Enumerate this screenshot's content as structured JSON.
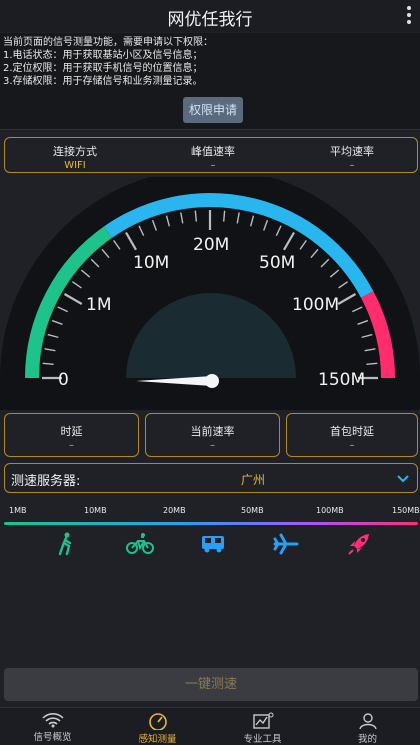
{
  "app": {
    "title": "网优任我行"
  },
  "permission": {
    "intro": "当前页面的信号测量功能，需要申请以下权限：",
    "items": [
      "1.电话状态：用于获取基站小区及信号信息；",
      "2.定位权限：用于获取手机信号的位置信息；",
      "3.存储权限：用于存储信号和业务测量记录。"
    ],
    "button": "权限申请"
  },
  "stats_top": {
    "connection_label": "连接方式",
    "connection_value": "WIFI",
    "peak_label": "峰值速率",
    "peak_value": "–",
    "avg_label": "平均速率",
    "avg_value": "–"
  },
  "gauge": {
    "labels": [
      "0",
      "1M",
      "10M",
      "20M",
      "50M",
      "100M",
      "150M"
    ],
    "current_speed_mbps": 0,
    "colors": {
      "low": "#1ec28b",
      "mid": "#29b6ee",
      "high": "#ff2d6f"
    }
  },
  "stats_bottom": {
    "latency_label": "时延",
    "latency_value": "–",
    "current_label": "当前速率",
    "current_value": "–",
    "first_packet_label": "首包时延",
    "first_packet_value": "–"
  },
  "server": {
    "label": "测速服务器:",
    "city": "广州"
  },
  "scale": {
    "labels": [
      "1MB",
      "10MB",
      "20MB",
      "50MB",
      "100MB",
      "150MB"
    ]
  },
  "modes": [
    "walk-icon",
    "bike-icon",
    "bus-icon",
    "plane-icon",
    "rocket-icon"
  ],
  "start_button": "一键测速",
  "nav": {
    "items": [
      "信号概览",
      "感知测量",
      "专业工具",
      "我的"
    ],
    "active": "感知测量"
  }
}
